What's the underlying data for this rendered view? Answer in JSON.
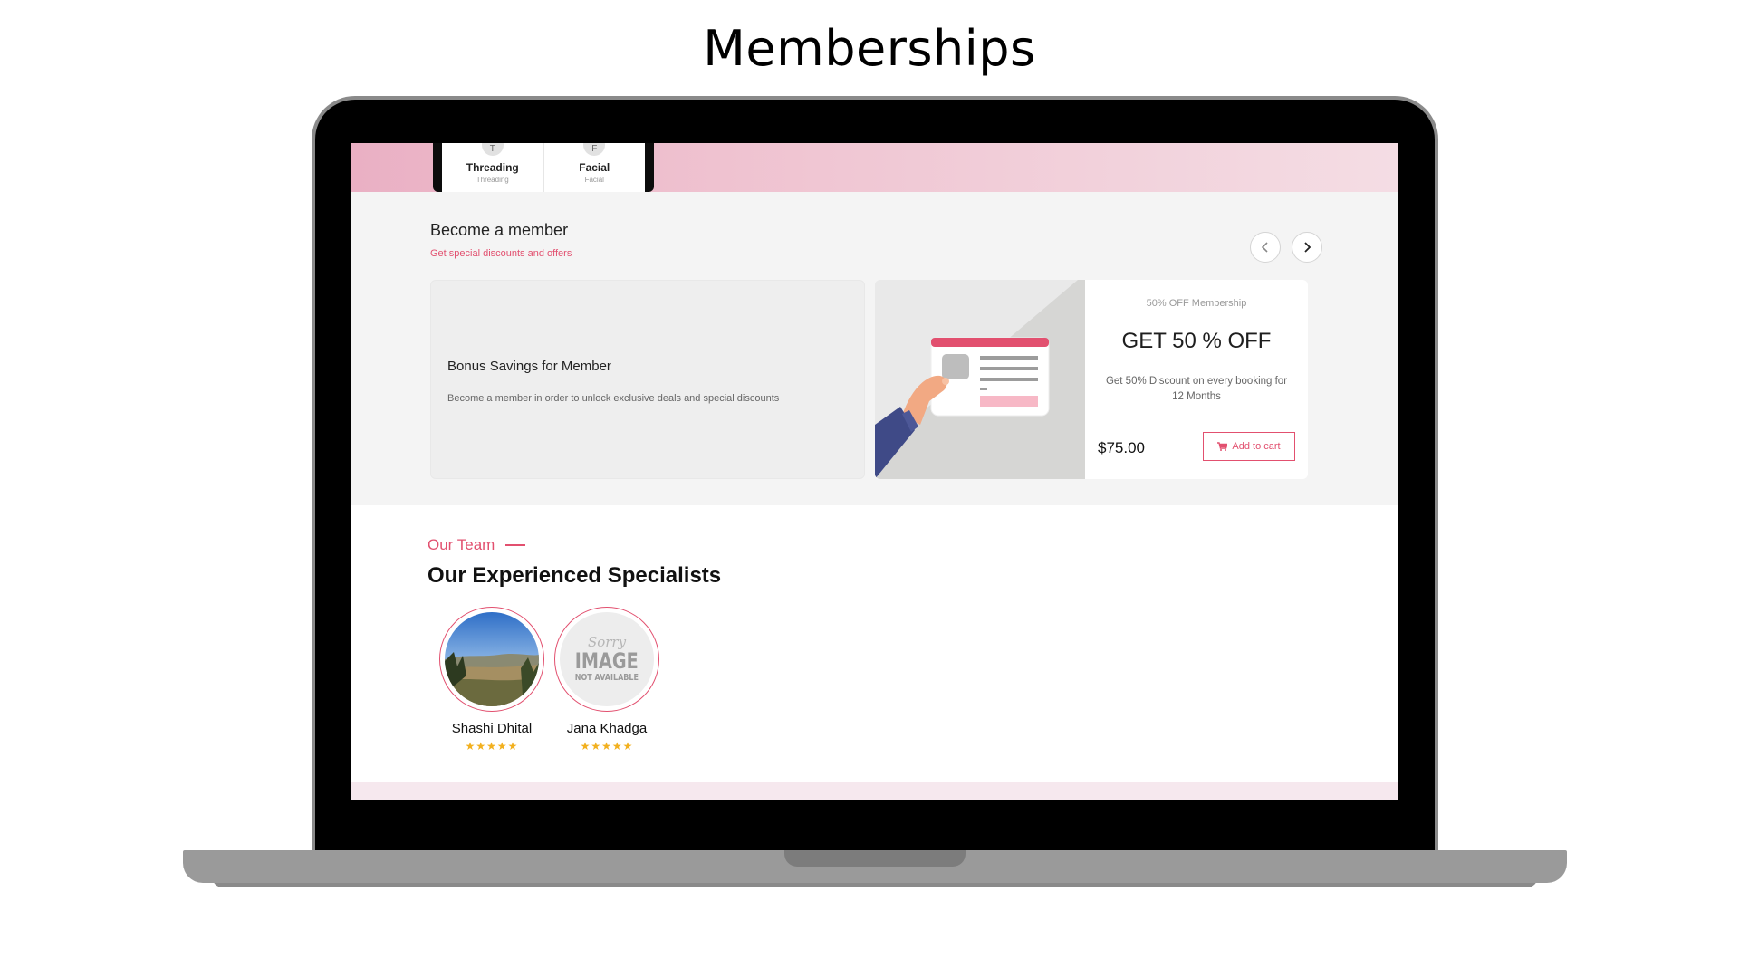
{
  "page": {
    "heading": "Memberships"
  },
  "services": [
    {
      "initial": "T",
      "name": "Threading",
      "sub": "Threading"
    },
    {
      "initial": "F",
      "name": "Facial",
      "sub": "Facial"
    }
  ],
  "membership": {
    "title": "Become a member",
    "subtitle": "Get special discounts and offers",
    "prev_icon": "chevron-left-icon",
    "next_icon": "chevron-right-icon",
    "bonus": {
      "title": "Bonus Savings for Member",
      "description": "Become a member in order to unlock exclusive deals and special discounts"
    },
    "offer": {
      "tag": "50% OFF Membership",
      "headline": "GET 50 % OFF",
      "description": "Get 50% Discount on every booking for 12 Months",
      "price": "$75.00",
      "cart_label": "Add to cart",
      "cart_icon": "cart-icon"
    }
  },
  "team": {
    "eyebrow": "Our Team",
    "title": "Our Experienced Specialists",
    "members": [
      {
        "name": "Shashi Dhital",
        "rating": 5,
        "photo": "landscape-photo"
      },
      {
        "name": "Jana Khadga",
        "rating": 5,
        "photo": "image-not-available-placeholder",
        "placeholder_lines": [
          "Sorry",
          "IMAGE",
          "NOT AVAILABLE"
        ]
      }
    ]
  },
  "colors": {
    "accent": "#e2506f",
    "star": "#f2b01e",
    "section_bg": "#f4f4f4"
  }
}
